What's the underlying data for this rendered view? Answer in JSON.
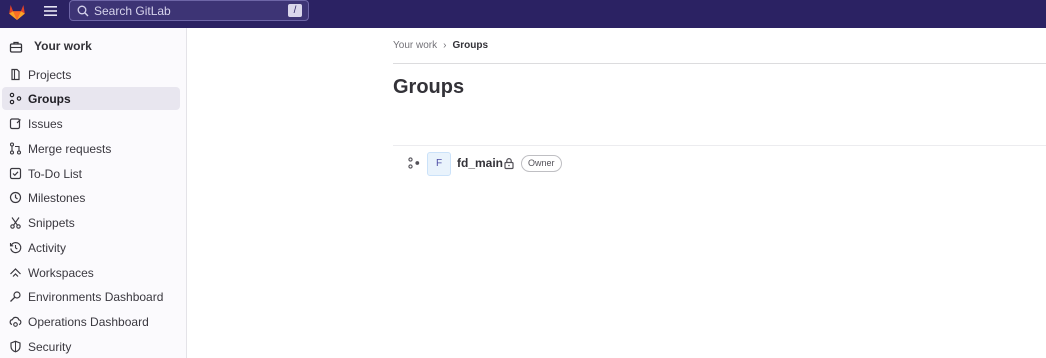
{
  "topbar": {
    "search": {
      "placeholder": "Search GitLab",
      "shortcut": "/"
    }
  },
  "sidebar": {
    "heading": "Your work",
    "items": [
      {
        "label": "Projects",
        "icon": "project-icon",
        "active": false
      },
      {
        "label": "Groups",
        "icon": "group-icon",
        "active": true
      },
      {
        "label": "Issues",
        "icon": "issues-icon",
        "active": false
      },
      {
        "label": "Merge requests",
        "icon": "merge-request-icon",
        "active": false
      },
      {
        "label": "To-Do List",
        "icon": "todo-icon",
        "active": false
      },
      {
        "label": "Milestones",
        "icon": "milestone-icon",
        "active": false
      },
      {
        "label": "Snippets",
        "icon": "snippet-icon",
        "active": false
      },
      {
        "label": "Activity",
        "icon": "history-icon",
        "active": false
      },
      {
        "label": "Workspaces",
        "icon": "workspace-icon",
        "active": false
      },
      {
        "label": "Environments Dashboard",
        "icon": "environment-icon",
        "active": false
      },
      {
        "label": "Operations Dashboard",
        "icon": "cloud-gear-icon",
        "active": false
      },
      {
        "label": "Security",
        "icon": "shield-icon",
        "active": false
      }
    ]
  },
  "breadcrumb": {
    "parent": "Your work",
    "current": "Groups"
  },
  "page": {
    "title": "Groups"
  },
  "groups": [
    {
      "avatar_letter": "F",
      "name": "fd_main",
      "visibility": "private",
      "role": "Owner"
    }
  ],
  "colors": {
    "topbar_bg": "#2b2263",
    "sidebar_bg": "#fbfafd",
    "active_item_bg": "#e8e6ef",
    "avatar_bg": "#e9f3fc"
  }
}
